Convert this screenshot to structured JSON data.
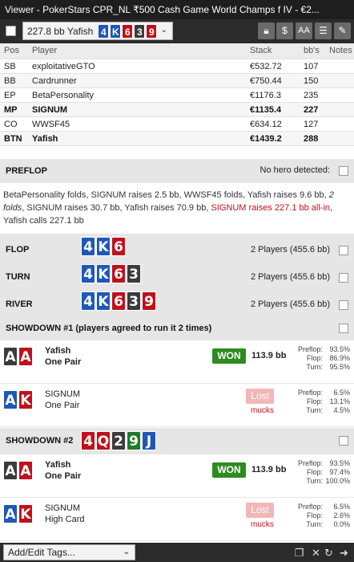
{
  "window": {
    "title": "Viewer - PokerStars CPR_NL ₹500 Cash Game World Champs f IV - €2..."
  },
  "toolbar": {
    "hand_label": "227.8 bb Yafish",
    "hand_cards": [
      {
        "rank": "4",
        "suit": "d"
      },
      {
        "rank": "K",
        "suit": "d"
      },
      {
        "rank": "6",
        "suit": "h"
      },
      {
        "rank": "3",
        "suit": "s"
      },
      {
        "rank": "9",
        "suit": "h"
      }
    ],
    "icons": [
      "lock-icon",
      "dollar-icon",
      "font-size-icon",
      "list-icon",
      "edit-icon"
    ]
  },
  "players_table": {
    "headers": {
      "pos": "Pos",
      "player": "Player",
      "stack": "Stack",
      "bbs": "bb's",
      "notes": "Notes"
    },
    "rows": [
      {
        "pos": "SB",
        "name": "exploitativeGTO",
        "stack": "€532.72",
        "bbs": "107",
        "bold": false
      },
      {
        "pos": "BB",
        "name": "Cardrunner",
        "stack": "€750.44",
        "bbs": "150",
        "bold": false
      },
      {
        "pos": "EP",
        "name": "BetaPersonality",
        "stack": "€1176.3",
        "bbs": "235",
        "bold": false
      },
      {
        "pos": "MP",
        "name": "SIGNUM",
        "stack": "€1135.4",
        "bbs": "227",
        "bold": true
      },
      {
        "pos": "CO",
        "name": "WWSF45",
        "stack": "€634.12",
        "bbs": "127",
        "bold": false
      },
      {
        "pos": "BTN",
        "name": "Yafish",
        "stack": "€1439.2",
        "bbs": "288",
        "bold": true
      }
    ]
  },
  "preflop": {
    "title": "PREFLOP",
    "hero_text": "No hero detected:",
    "actions_part1": "BetaPersonality folds, SIGNUM raises 2.5 bb, WWSF45 folds, Yafish raises 9.6 bb, ",
    "actions_italic": "2 folds",
    "actions_part2": ", SIGNUM raises 30.7 bb, Yafish raises 70.9 bb, ",
    "actions_red": "SIGNUM raises 227.1 bb all-in",
    "actions_part3": ", Yafish calls 227.1 bb"
  },
  "streets": [
    {
      "name": "FLOP",
      "players": "2 Players (455.6 bb)",
      "cards": [
        {
          "rank": "4",
          "suit": "d"
        },
        {
          "rank": "K",
          "suit": "d"
        },
        {
          "rank": "6",
          "suit": "h"
        }
      ]
    },
    {
      "name": "TURN",
      "players": "2 Players (455.6 bb)",
      "cards": [
        {
          "rank": "4",
          "suit": "d"
        },
        {
          "rank": "K",
          "suit": "d"
        },
        {
          "rank": "6",
          "suit": "h"
        },
        {
          "rank": "3",
          "suit": "s"
        }
      ]
    },
    {
      "name": "RIVER",
      "players": "2 Players (455.6 bb)",
      "cards": [
        {
          "rank": "4",
          "suit": "d"
        },
        {
          "rank": "K",
          "suit": "d"
        },
        {
          "rank": "6",
          "suit": "h"
        },
        {
          "rank": "3",
          "suit": "s"
        },
        {
          "rank": "9",
          "suit": "h"
        }
      ]
    }
  ],
  "showdown1": {
    "title": "SHOWDOWN #1 (players agreed to run it 2 times)",
    "players": [
      {
        "name": "Yafish",
        "hand": "One Pair",
        "cards": [
          {
            "rank": "A",
            "suit": "s"
          },
          {
            "rank": "A",
            "suit": "h"
          }
        ],
        "result": "WON",
        "amount": "113.9 bb",
        "eq": [
          [
            "Preflop:",
            "93.5%"
          ],
          [
            "Flop:",
            "86.9%"
          ],
          [
            "Turn:",
            "95.5%"
          ]
        ],
        "bold": true
      },
      {
        "name": "SIGNUM",
        "hand": "One Pair",
        "cards": [
          {
            "rank": "A",
            "suit": "d"
          },
          {
            "rank": "K",
            "suit": "h"
          }
        ],
        "result": "Lost",
        "mucks": "mucks",
        "eq": [
          [
            "Preflop:",
            "6.5%"
          ],
          [
            "Flop:",
            "13.1%"
          ],
          [
            "Turn:",
            "4.5%"
          ]
        ],
        "bold": false
      }
    ]
  },
  "showdown2": {
    "title": "SHOWDOWN #2",
    "cards": [
      {
        "rank": "4",
        "suit": "h"
      },
      {
        "rank": "Q",
        "suit": "h"
      },
      {
        "rank": "2",
        "suit": "s"
      },
      {
        "rank": "9",
        "suit": "c"
      },
      {
        "rank": "J",
        "suit": "d"
      }
    ],
    "players": [
      {
        "name": "Yafish",
        "hand": "One Pair",
        "cards": [
          {
            "rank": "A",
            "suit": "s"
          },
          {
            "rank": "A",
            "suit": "h"
          }
        ],
        "result": "WON",
        "amount": "113.9 bb",
        "eq": [
          [
            "Preflop:",
            "93.5%"
          ],
          [
            "Flop:",
            "97.4%"
          ],
          [
            "Turn:",
            "100.0%"
          ]
        ],
        "bold": true
      },
      {
        "name": "SIGNUM",
        "hand": "High Card",
        "cards": [
          {
            "rank": "A",
            "suit": "d"
          },
          {
            "rank": "K",
            "suit": "h"
          }
        ],
        "result": "Lost",
        "mucks": "mucks",
        "eq": [
          [
            "Preflop:",
            "6.5%"
          ],
          [
            "Flop:",
            "2.6%"
          ],
          [
            "Turn:",
            "0.0%"
          ]
        ],
        "bold": false
      }
    ]
  },
  "footer": {
    "tags_label": "Add/Edit Tags...",
    "icons": [
      "copy-icon",
      "close-icon",
      "refresh-icon",
      "forward-icon"
    ]
  }
}
